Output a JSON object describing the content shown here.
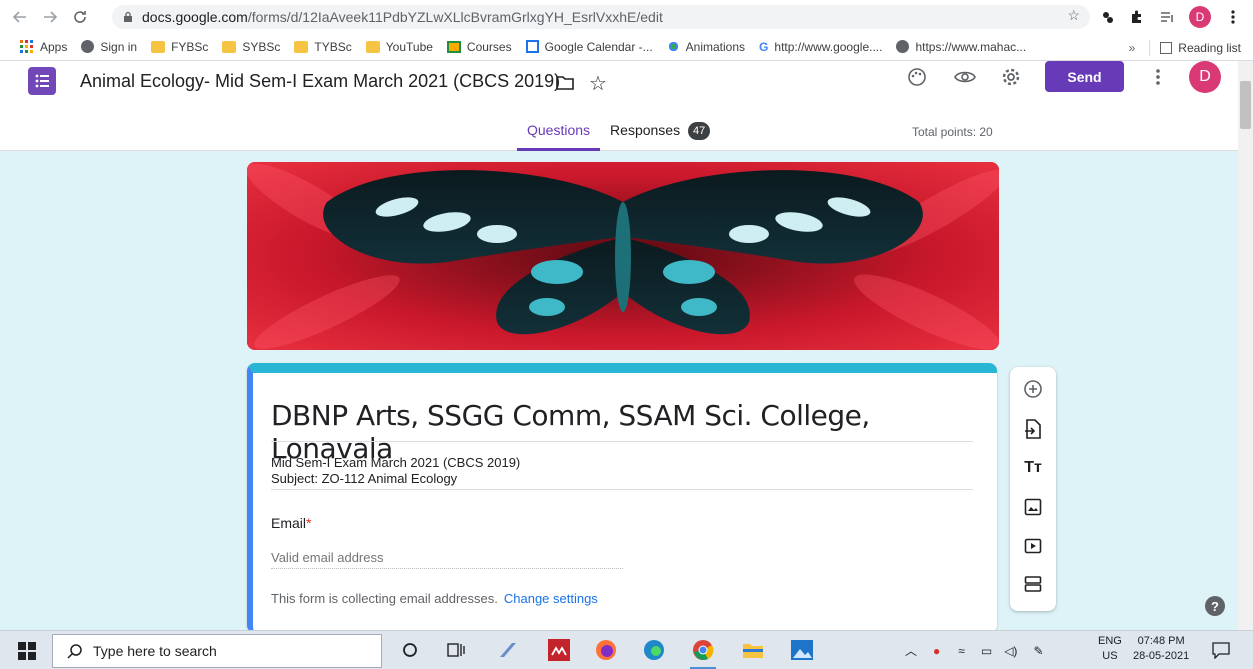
{
  "browser": {
    "url_host": "docs.google.com",
    "url_path": "/forms/d/12IaAveek11PdbYZLwXLlcBvramGrlxgYH_EsrlVxxhE/edit",
    "avatar_letter": "D",
    "bookmarks": [
      {
        "label": "Apps",
        "icon": "apps-grid-icon"
      },
      {
        "label": "Sign in",
        "icon": "globe-icon"
      },
      {
        "label": "FYBSc",
        "icon": "folder-icon"
      },
      {
        "label": "SYBSc",
        "icon": "folder-icon"
      },
      {
        "label": "TYBSc",
        "icon": "folder-icon"
      },
      {
        "label": "YouTube",
        "icon": "folder-icon"
      },
      {
        "label": "Courses",
        "icon": "classroom-icon"
      },
      {
        "label": "Google Calendar -...",
        "icon": "calendar-icon"
      },
      {
        "label": "Animations",
        "icon": "animations-icon"
      },
      {
        "label": "http://www.google....",
        "icon": "google-icon"
      },
      {
        "label": "https://www.mahac...",
        "icon": "globe-icon"
      }
    ],
    "overflow": "»",
    "reading_list": "Reading list"
  },
  "header": {
    "title": "Animal Ecology- Mid Sem-I Exam March 2021 (CBCS 2019)",
    "send_label": "Send",
    "avatar_letter": "D",
    "tabs": [
      {
        "label": "Questions",
        "active": true
      },
      {
        "label": "Responses",
        "count": "47"
      }
    ],
    "total_points": "Total points: 20"
  },
  "form": {
    "title": "DBNP Arts, SSGG Comm, SSAM Sci. College, Lonavala",
    "description_line1": "Mid Sem-I Exam March 2021 (CBCS 2019)",
    "description_line2": "Subject: ZO-112 Animal Ecology",
    "email_label": "Email",
    "required_mark": "*",
    "email_placeholder": "Valid email address",
    "collecting_note": "This form is collecting email addresses.",
    "change_settings": "Change settings",
    "theme_color": "#29b6d4",
    "accent": "#673ab7"
  },
  "side_toolbar": [
    "add-question-icon",
    "import-questions-icon",
    "add-title-icon",
    "add-image-icon",
    "add-video-icon",
    "add-section-icon"
  ],
  "help_label": "?",
  "taskbar": {
    "search_placeholder": "Type here to search",
    "lang_top": "ENG",
    "lang_bottom": "US",
    "time": "07:48 PM",
    "date": "28-05-2021"
  }
}
